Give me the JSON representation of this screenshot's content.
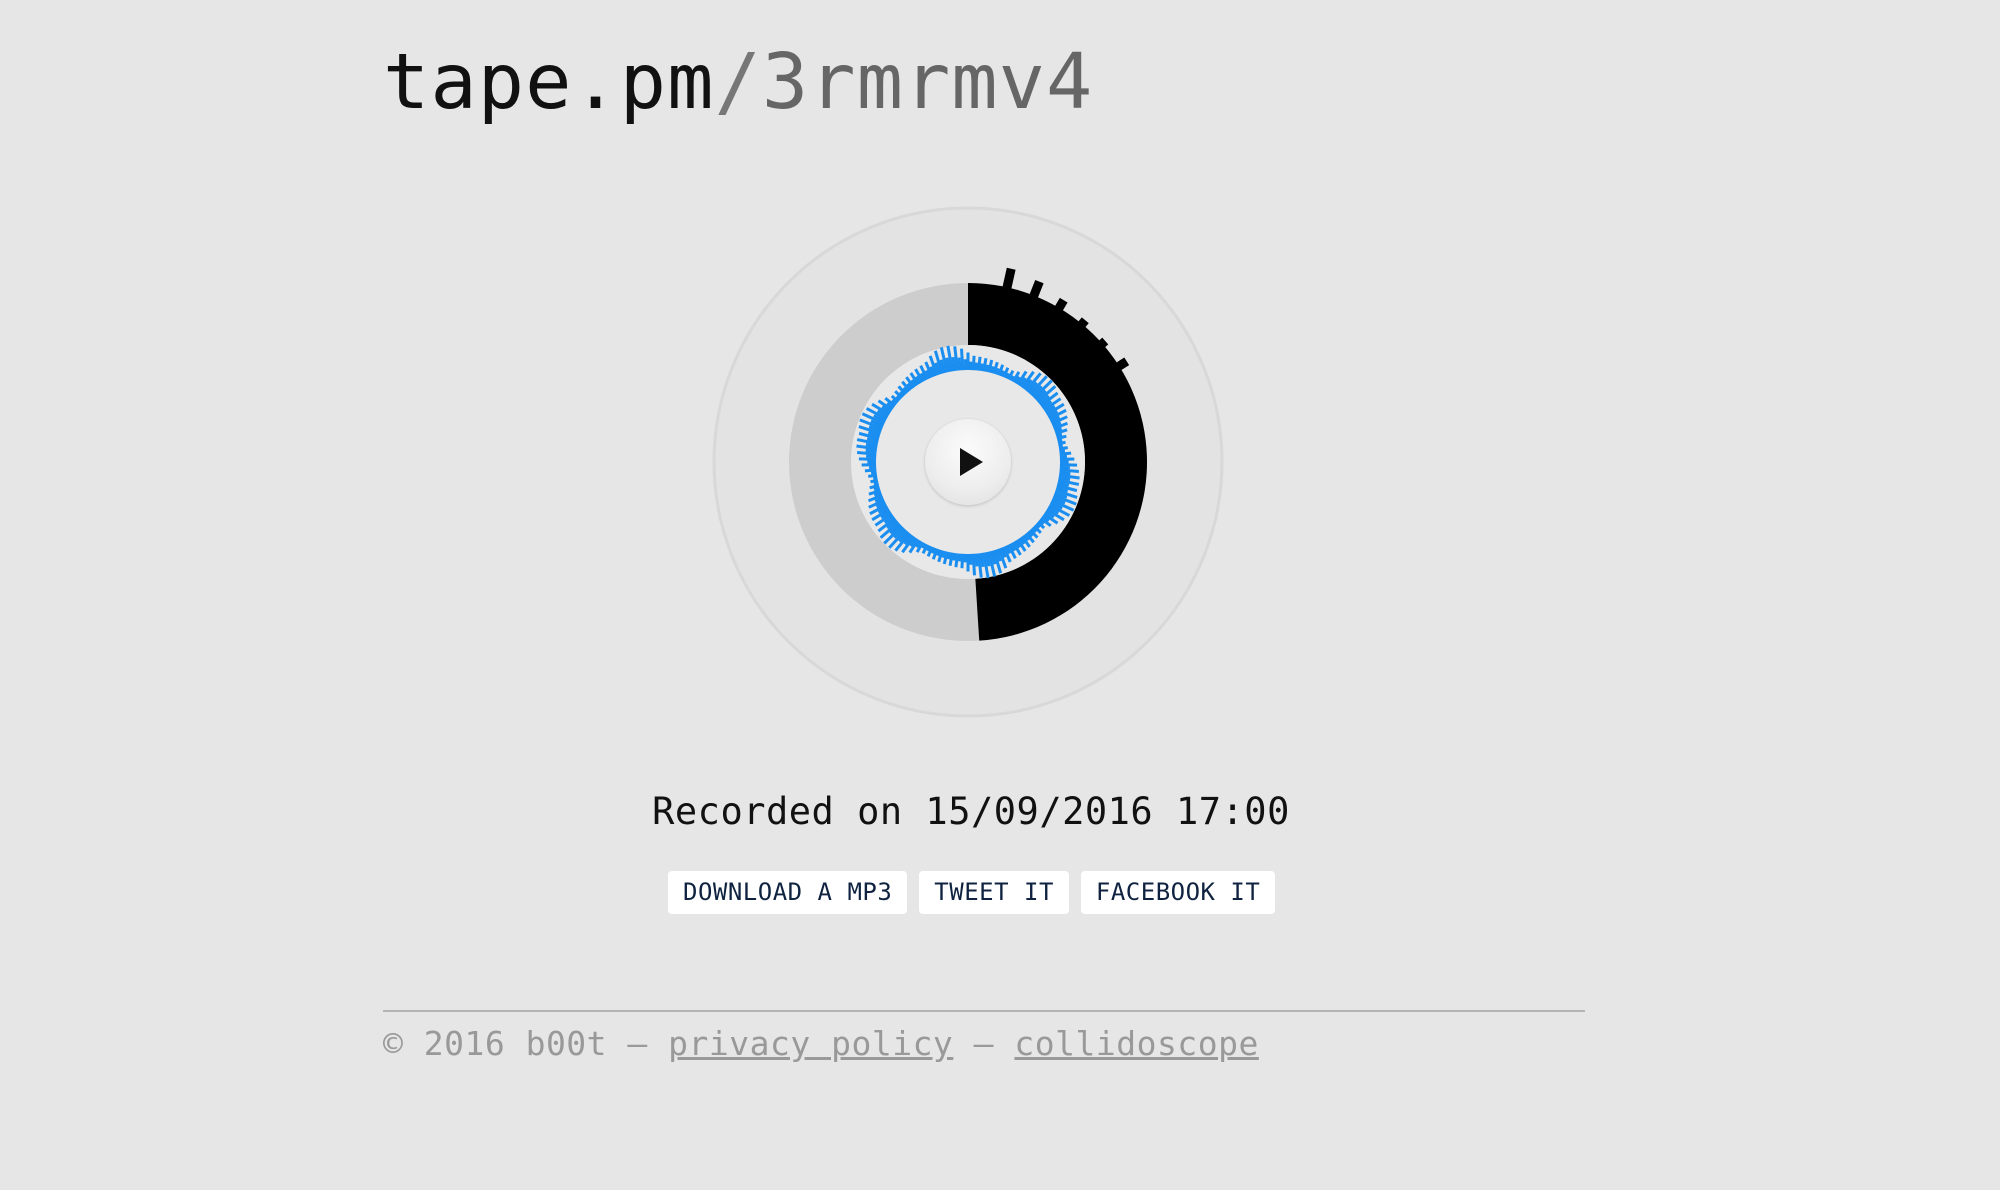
{
  "header": {
    "domain": "tape.pm",
    "separator": "/",
    "tape_id": "3rmrmv4"
  },
  "player": {
    "play_icon": "play-icon",
    "progress": 0.49,
    "colors": {
      "outer_disc": "#e3e3e3",
      "inner_disc": "#cdcdcd",
      "progress": "#000000",
      "waveform": "#1a8ef0"
    }
  },
  "recording": {
    "recorded_text": "Recorded on 15/09/2016 17:00"
  },
  "actions": {
    "download_label": "DOWNLOAD A MP3",
    "tweet_label": "TWEET IT",
    "facebook_label": "FACEBOOK IT"
  },
  "footer": {
    "copyright": "© 2016 b00t",
    "separator": " — ",
    "privacy_label": "privacy policy",
    "collidoscope_label": "collidoscope"
  }
}
